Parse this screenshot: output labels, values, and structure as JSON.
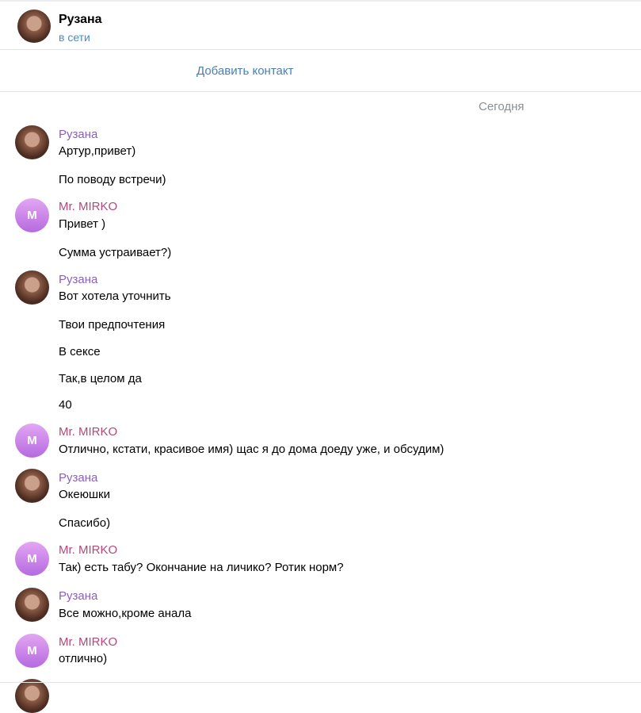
{
  "header": {
    "name": "Рузана",
    "status": "в сети"
  },
  "add_contact_label": "Добавить контакт",
  "date_label": "Сегодня",
  "messages": [
    {
      "author": "Рузана",
      "lines": [
        "Артур,привет)",
        "По поводу встречи)"
      ]
    },
    {
      "author": "Mr. MIRKO",
      "avatar_letter": "M",
      "lines": [
        "Привет )",
        "Сумма устраивает?)"
      ]
    },
    {
      "author": "Рузана",
      "lines": [
        "Вот хотела уточнить",
        "Твои предпочтения",
        "В сексе",
        "Так,в целом да",
        "40"
      ]
    },
    {
      "author": "Mr. MIRKO",
      "avatar_letter": "M",
      "lines": [
        "Отлично, кстати, красивое имя) щас я до дома доеду уже, и обсудим)"
      ]
    },
    {
      "author": "Рузана",
      "lines": [
        "Океюшки",
        "Спасибо)"
      ]
    },
    {
      "author": "Mr. MIRKO",
      "avatar_letter": "M",
      "lines": [
        "Так) есть табу? Окончание на личико? Ротик норм?"
      ]
    },
    {
      "author": "Рузана",
      "lines": [
        "Все можно,кроме анала"
      ]
    },
    {
      "author": "Mr. MIRKO",
      "avatar_letter": "M",
      "lines": [
        "отлично)"
      ]
    }
  ],
  "colors": {
    "link": "#4a7fb5",
    "online": "#4a8ac9",
    "author_rusana": "#8a5fbf",
    "author_mirko": "#b0497a"
  }
}
